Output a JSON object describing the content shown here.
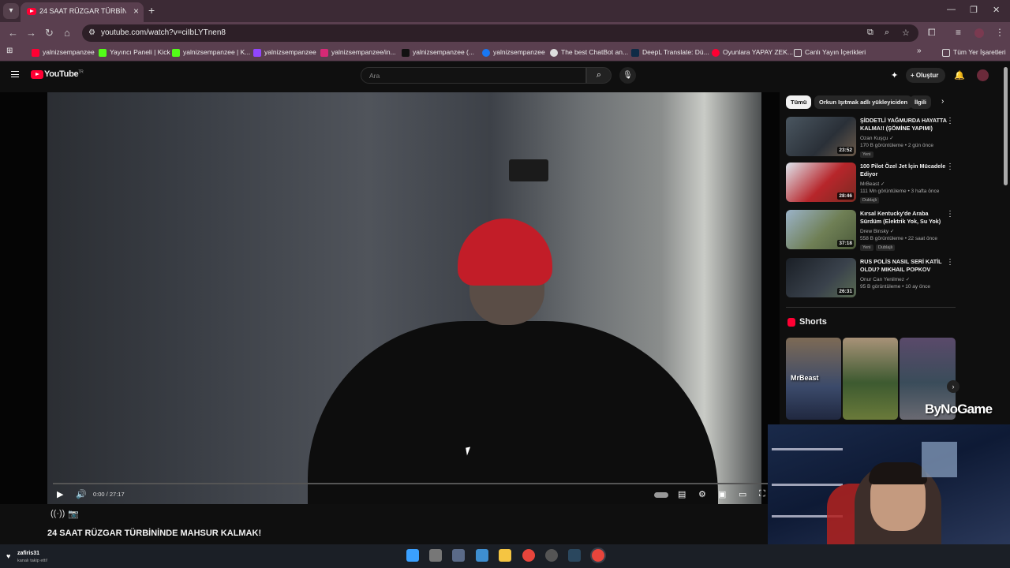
{
  "browser": {
    "tab_title": "24 SAAT RÜZGAR TÜRBİNİNDE",
    "url": "youtube.com/watch?v=ciIbLYTnen8",
    "bookmarks": [
      "yalnizsempanzee",
      "Yayıncı Paneli | Kick",
      "yalnizsempanzee | K...",
      "yalnizsempanzee",
      "yalnizsempanzee/in...",
      "yalnizsempanzee (...",
      "yalnizsempanzee",
      "The best ChatBot an...",
      "DeepL Translate: Dü...",
      "Oyunlara YAPAY ZEK...",
      "Canlı Yayın İçerikleri"
    ],
    "all_bookmarks": "Tüm Yer İşaretleri"
  },
  "youtube": {
    "logo_text": "YouTube",
    "logo_region": "TR",
    "search_placeholder": "Ara",
    "create_label": "Oluştur"
  },
  "player": {
    "time": "0:00 / 27:17",
    "progress_fraction": 0
  },
  "video_title": "24 SAAT RÜZGAR TÜRBİNİNDE MAHSUR KALMAK!",
  "chips": [
    "Tümü",
    "Orkun Işıtmak adlı yükleyiciden",
    "İlgili"
  ],
  "recommendations": [
    {
      "title": "ŞİDDETLİ YAĞMURDA HAYATTA KALMA!! (ŞÖMİNE YAPIMI)",
      "channel": "Ozan Kuşçu ✓",
      "meta": "170 B görüntüleme • 2 gün önce",
      "duration": "23:52",
      "tags": [
        "Yeni"
      ]
    },
    {
      "title": "100 Pilot Özel Jet İçin Mücadele Ediyor",
      "channel": "MrBeast ✓",
      "meta": "111 Mn görüntüleme • 3 hafta önce",
      "duration": "28:46",
      "tags": [
        "Dublajlı"
      ]
    },
    {
      "title": "Kırsal Kentucky'de Araba Sürdüm (Elektrik Yok, Su Yok)",
      "channel": "Drew Binsky ✓",
      "meta": "558 B görüntüleme • 22 saat önce",
      "duration": "37:18",
      "tags": [
        "Yeni",
        "Dublajlı"
      ]
    },
    {
      "title": "RUS POLİS NASIL SERİ KATİL OLDU? MIKHAIL POPKOV",
      "channel": "Onur Can Yenilmez ✓",
      "meta": "95 B görüntüleme • 10 ay önce",
      "duration": "26:31",
      "tags": []
    }
  ],
  "shorts": {
    "heading": "Shorts",
    "overlay_text": "MrBeast"
  },
  "overlay": {
    "watermark": "ByNoGame",
    "follower_name": "zafiris31",
    "follower_sub": "kanalı takip etti!"
  }
}
